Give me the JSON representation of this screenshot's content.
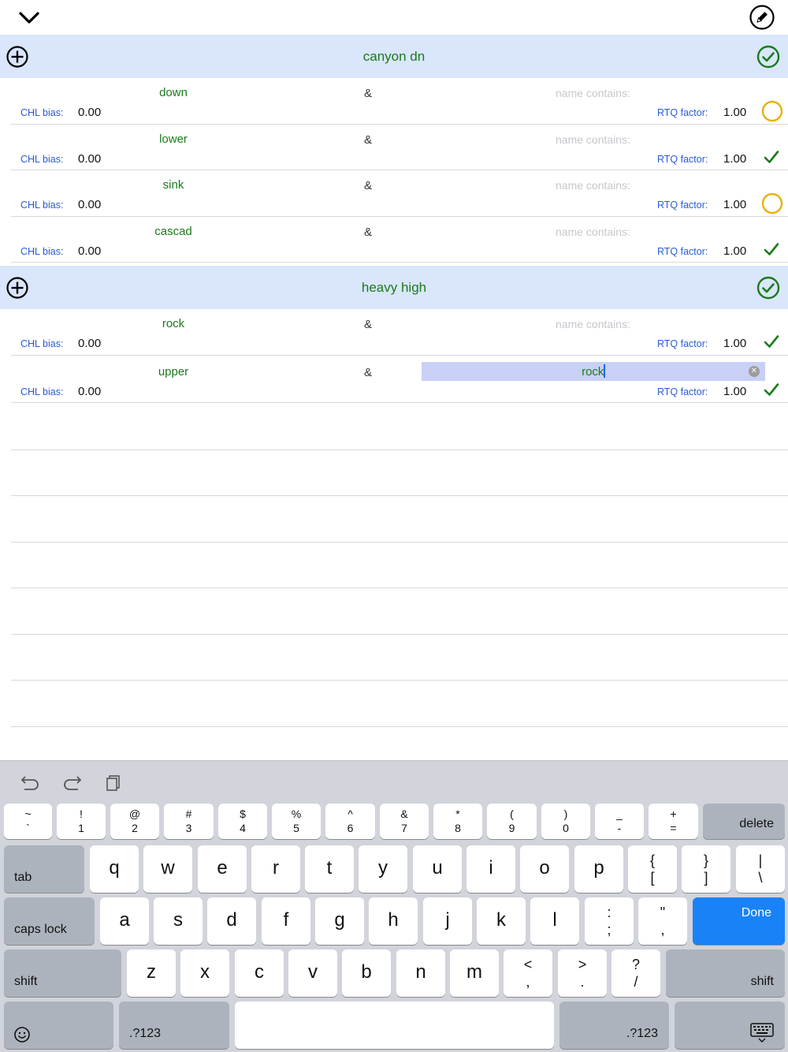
{
  "topbar": {
    "collapse_icon": "chevron-down-icon",
    "edit_icon": "pencil-circle-icon"
  },
  "colors": {
    "header_bg": "#d9e6fb",
    "accent_green": "#1b7a1b",
    "label_blue": "#2a5bd7",
    "pending_yellow": "#e6b10f",
    "keyboard_done": "#1a82f7"
  },
  "sections": [
    {
      "title": "canyon dn",
      "rows": [
        {
          "word": "down",
          "amp": "&",
          "contains": "name contains:",
          "chl_label": "CHL bias:",
          "chl_value": "0.00",
          "rtq_label": "RTQ factor:",
          "rtq_value": "1.00",
          "status": "pending"
        },
        {
          "word": "lower",
          "amp": "&",
          "contains": "name contains:",
          "chl_label": "CHL bias:",
          "chl_value": "0.00",
          "rtq_label": "RTQ factor:",
          "rtq_value": "1.00",
          "status": "ok"
        },
        {
          "word": "sink",
          "amp": "&",
          "contains": "name contains:",
          "chl_label": "CHL bias:",
          "chl_value": "0.00",
          "rtq_label": "RTQ factor:",
          "rtq_value": "1.00",
          "status": "pending"
        },
        {
          "word": "cascad",
          "amp": "&",
          "contains": "name contains:",
          "chl_label": "CHL bias:",
          "chl_value": "0.00",
          "rtq_label": "RTQ factor:",
          "rtq_value": "1.00",
          "status": "ok"
        }
      ]
    },
    {
      "title": "heavy high",
      "rows": [
        {
          "word": "rock",
          "amp": "&",
          "contains": "name contains:",
          "chl_label": "CHL bias:",
          "chl_value": "0.00",
          "rtq_label": "RTQ factor:",
          "rtq_value": "1.00",
          "status": "ok"
        },
        {
          "word": "upper",
          "amp": "&",
          "contains_value": "rock",
          "chl_label": "CHL bias:",
          "chl_value": "0.00",
          "rtq_label": "RTQ factor:",
          "rtq_value": "1.00",
          "status": "ok"
        }
      ]
    }
  ],
  "keyboard": {
    "num_row": [
      [
        "~",
        "`"
      ],
      [
        "!",
        "1"
      ],
      [
        "@",
        "2"
      ],
      [
        "#",
        "3"
      ],
      [
        "$",
        "4"
      ],
      [
        "%",
        "5"
      ],
      [
        "^",
        "6"
      ],
      [
        "&",
        "7"
      ],
      [
        "*",
        "8"
      ],
      [
        "(",
        "9"
      ],
      [
        ")",
        "0"
      ],
      [
        "_",
        "-"
      ],
      [
        "+",
        "="
      ]
    ],
    "delete": "delete",
    "tab": "tab",
    "row_q": [
      "q",
      "w",
      "e",
      "r",
      "t",
      "y",
      "u",
      "i",
      "o",
      "p"
    ],
    "brackets": [
      [
        "{",
        "["
      ],
      [
        "}",
        "]"
      ],
      [
        "|",
        "\\"
      ]
    ],
    "caps": "caps lock",
    "row_a": [
      "a",
      "s",
      "d",
      "f",
      "g",
      "h",
      "j",
      "k",
      "l"
    ],
    "punct": [
      [
        ":",
        ";"
      ],
      [
        "\"",
        ","
      ]
    ],
    "done": "Done",
    "shift": "shift",
    "row_z": [
      "z",
      "x",
      "c",
      "v",
      "b",
      "n",
      "m"
    ],
    "punct2": [
      [
        "<",
        ","
      ],
      [
        ">",
        "."
      ],
      [
        "?",
        "/"
      ]
    ],
    "mode": ".?123"
  }
}
